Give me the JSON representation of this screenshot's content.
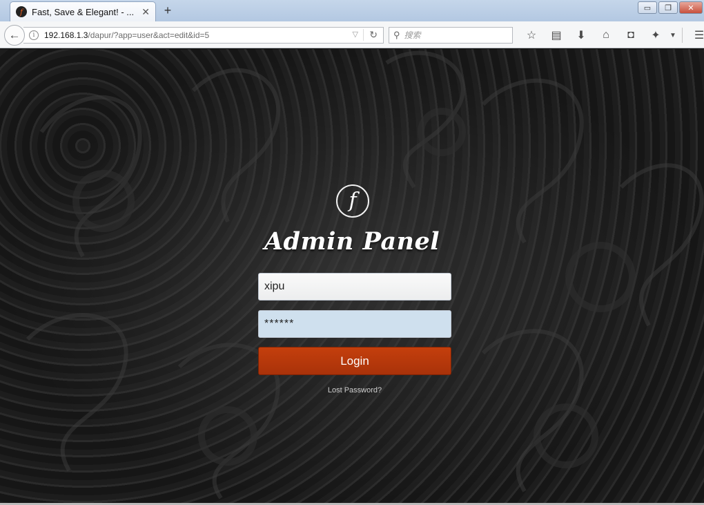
{
  "browser": {
    "tab": {
      "title": "Fast, Save & Elegant! - ...",
      "close_glyph": "✕",
      "favicon": "f"
    },
    "new_tab_glyph": "+",
    "window_buttons": {
      "minimize": "▭",
      "restore": "❐",
      "close": "✕"
    },
    "url": {
      "host": "192.168.1.3",
      "path": "/dapur/?app=user&act=edit&id=5"
    },
    "search": {
      "placeholder": "搜索"
    },
    "icons": {
      "back": "back-arrow-icon",
      "info": "info-icon",
      "dropdown": "dropdown-arrow-icon",
      "reload": "reload-icon",
      "search": "search-icon",
      "bookmark": "star-icon",
      "reading_list": "clipboard-icon",
      "downloads": "download-icon",
      "home": "home-icon",
      "pocket": "pocket-icon",
      "addon": "extension-icon",
      "menu": "hamburger-menu-icon"
    }
  },
  "page": {
    "logo_letter": "f",
    "title": "Admin Panel",
    "username_value": "xipu",
    "password_value": "******",
    "login_label": "Login",
    "lost_password_label": "Lost Password?",
    "colors": {
      "login_button": "#b5370b",
      "password_bg": "#cfe0ee"
    }
  }
}
